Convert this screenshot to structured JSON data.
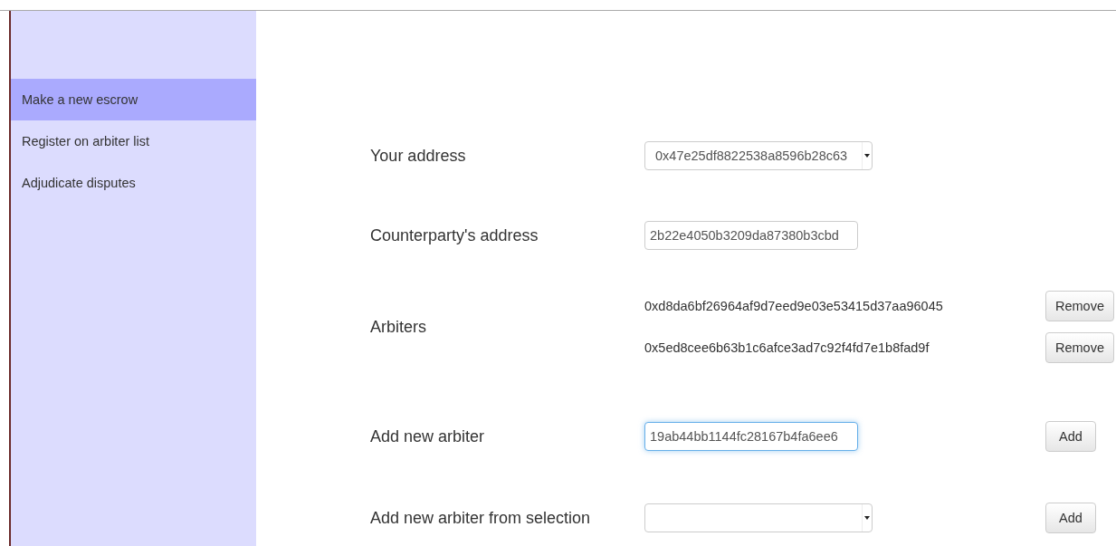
{
  "sidebar": {
    "items": [
      {
        "label": "Make a new escrow",
        "selected": true
      },
      {
        "label": "Register on arbiter list",
        "selected": false
      },
      {
        "label": "Adjudicate disputes",
        "selected": false
      }
    ]
  },
  "form": {
    "your_address": {
      "label": "Your address",
      "kind": "select",
      "value": "0x47e25df8822538a8596b28c63"
    },
    "counterparty": {
      "label": "Counterparty's address",
      "value": "2b22e4050b3209da87380b3cbd"
    },
    "arbiters": {
      "label": "Arbiters",
      "items": [
        {
          "address": "0xd8da6bf26964af9d7eed9e03e53415d37aa96045",
          "button": "Remove"
        },
        {
          "address": "0x5ed8cee6b63b1c6afce3ad7c92f4fd7e1b8fad9f",
          "button": "Remove"
        }
      ]
    },
    "new_arbiter": {
      "label": "Add new arbiter",
      "value": "19ab44bb1144fc28167b4fa6ee6",
      "focused": true,
      "button": "Add"
    },
    "from_selection": {
      "label": "Add new arbiter from selection",
      "kind": "select",
      "button": "Add"
    }
  }
}
